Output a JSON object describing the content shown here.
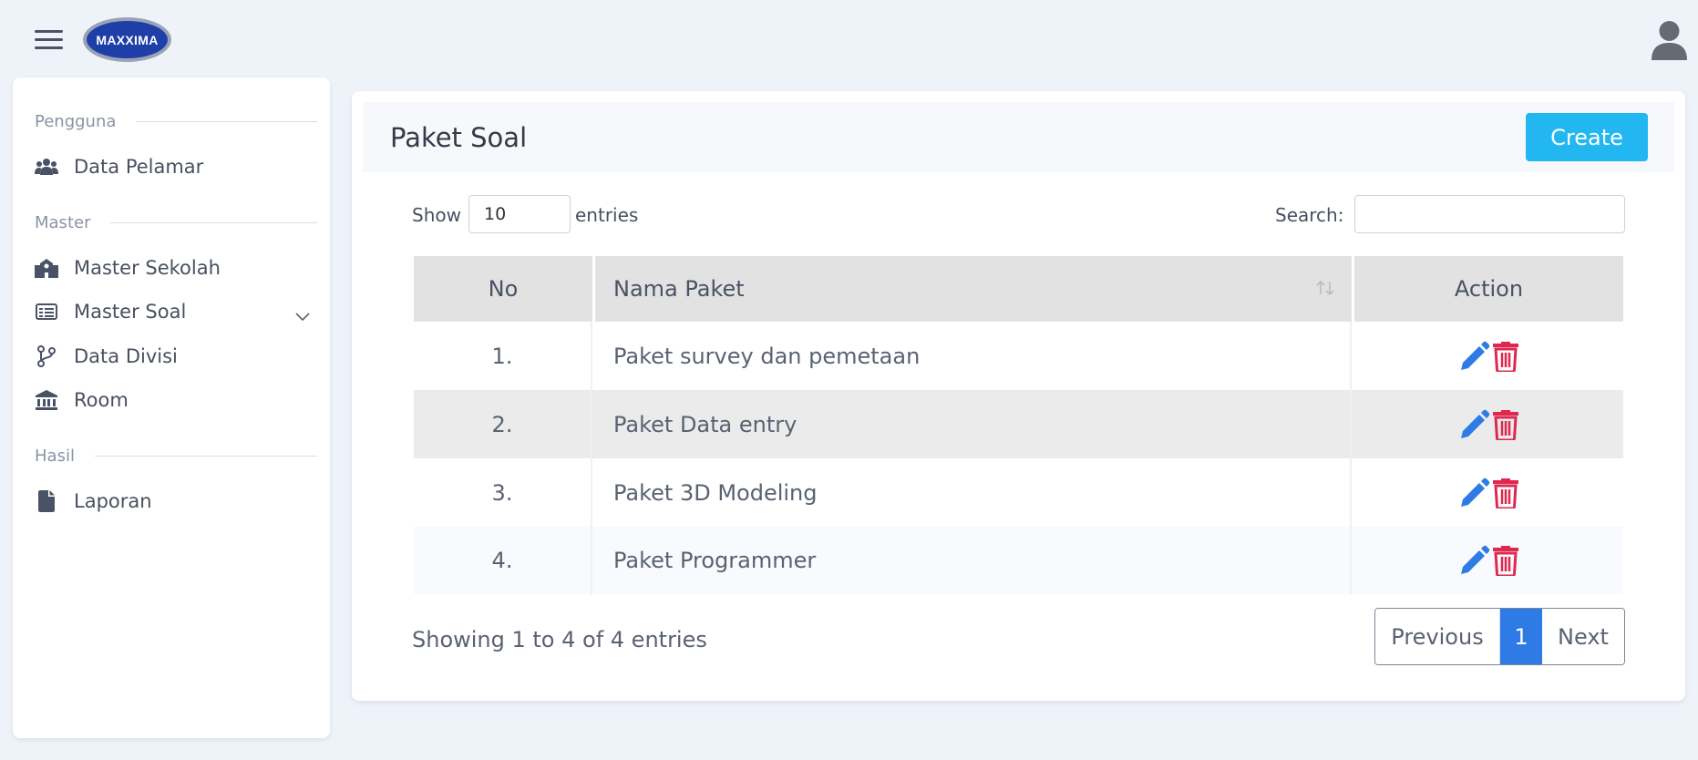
{
  "brand": {
    "logo_text": "MAXXIMA"
  },
  "sidebar": {
    "sections": [
      {
        "title": "Pengguna"
      },
      {
        "title": "Master"
      },
      {
        "title": "Hasil"
      }
    ],
    "items": [
      {
        "label": "Data Pelamar",
        "icon": "users-icon"
      },
      {
        "label": "Master Sekolah",
        "icon": "school-icon"
      },
      {
        "label": "Master Soal",
        "icon": "list-icon"
      },
      {
        "label": "Data Divisi",
        "icon": "branch-icon"
      },
      {
        "label": "Room",
        "icon": "building-icon"
      },
      {
        "label": "Laporan",
        "icon": "file-icon"
      }
    ]
  },
  "main": {
    "title": "Paket Soal",
    "create_label": "Create",
    "show_label": "Show",
    "entries_value": "10",
    "entries_label": "entries",
    "search_label": "Search:",
    "search_value": "",
    "table": {
      "headers": [
        "No",
        "Nama Paket",
        "Action"
      ],
      "rows": [
        {
          "no": "1.",
          "name": "Paket survey dan pemetaan"
        },
        {
          "no": "2.",
          "name": "Paket Data entry"
        },
        {
          "no": "3.",
          "name": "Paket 3D Modeling"
        },
        {
          "no": "4.",
          "name": "Paket Programmer"
        }
      ]
    },
    "info": "Showing 1 to 4 of 4 entries",
    "pagination": {
      "previous": "Previous",
      "current": "1",
      "next": "Next"
    }
  },
  "colors": {
    "accent": "#22b7f0",
    "primary": "#2f7be5",
    "danger": "#e0284f",
    "edit": "#2f7be5"
  }
}
